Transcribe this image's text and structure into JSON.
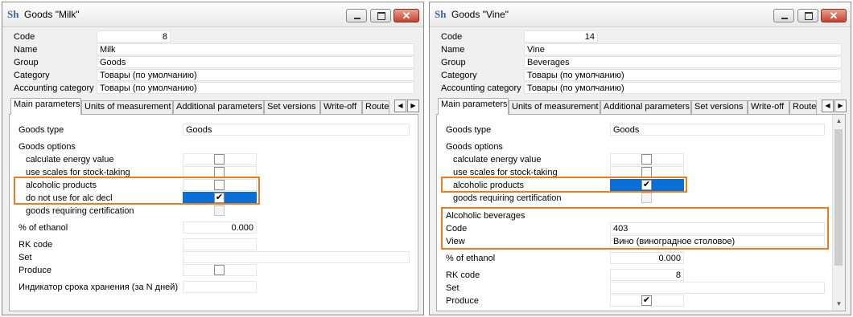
{
  "windows": [
    {
      "title": "Goods \"Milk\"",
      "close_glyph": "✕",
      "fields": {
        "code": {
          "label": "Code",
          "value": "8"
        },
        "name": {
          "label": "Name",
          "value": "Milk"
        },
        "group": {
          "label": "Group",
          "value": "Goods"
        },
        "category": {
          "label": "Category",
          "value": "Товары (по умолчанию)"
        },
        "accounting_category": {
          "label": "Accounting category",
          "value": "Товары (по умолчанию)"
        }
      },
      "tabs": [
        "Main parameters",
        "Units of measurement",
        "Additional parameters",
        "Set versions",
        "Write-off",
        "Route"
      ],
      "main": {
        "goods_type": {
          "label": "Goods type",
          "value": "Goods"
        },
        "goods_options": {
          "label": "Goods options"
        },
        "calc_energy": {
          "label": "calculate energy value",
          "checked": ""
        },
        "use_scales": {
          "label": "use scales for stock-taking",
          "checked": ""
        },
        "alcoholic": {
          "label": "alcoholic products",
          "checked": ""
        },
        "no_alc_decl": {
          "label": "do not use for alc decl",
          "checked": "✔"
        },
        "certification": {
          "label": "goods requiring certification",
          "checked": ""
        },
        "ethanol": {
          "label": "% of ethanol",
          "value": "0.000"
        },
        "rk_code": {
          "label": "RK code",
          "value": ""
        },
        "set": {
          "label": "Set",
          "value": ""
        },
        "produce": {
          "label": "Produce",
          "checked": ""
        },
        "shelf_life": {
          "label": "Индикатор срока хранения (за N дней)",
          "value": ""
        }
      }
    },
    {
      "title": "Goods \"Vine\"",
      "close_glyph": "✕",
      "fields": {
        "code": {
          "label": "Code",
          "value": "14"
        },
        "name": {
          "label": "Name",
          "value": "Vine"
        },
        "group": {
          "label": "Group",
          "value": "Beverages"
        },
        "category": {
          "label": "Category",
          "value": "Товары (по умолчанию)"
        },
        "accounting_category": {
          "label": "Accounting category",
          "value": "Товары (по умолчанию)"
        }
      },
      "tabs": [
        "Main parameters",
        "Units of measurement",
        "Additional parameters",
        "Set versions",
        "Write-off",
        "Route"
      ],
      "main": {
        "goods_type": {
          "label": "Goods type",
          "value": "Goods"
        },
        "goods_options": {
          "label": "Goods options"
        },
        "calc_energy": {
          "label": "calculate energy value",
          "checked": ""
        },
        "use_scales": {
          "label": "use scales for stock-taking",
          "checked": ""
        },
        "alcoholic": {
          "label": "alcoholic products",
          "checked": "✔"
        },
        "certification": {
          "label": "goods requiring certification",
          "checked": ""
        },
        "alc_bev": {
          "label": "Alcoholic beverages"
        },
        "alc_code": {
          "label": "Code",
          "value": "403"
        },
        "alc_view": {
          "label": "View",
          "value": "Вино (виноградное столовое)"
        },
        "ethanol": {
          "label": "% of ethanol",
          "value": "0.000"
        },
        "rk_code": {
          "label": "RK code",
          "value": "8"
        },
        "set": {
          "label": "Set",
          "value": ""
        },
        "produce": {
          "label": "Produce",
          "checked": "✔"
        }
      }
    }
  ],
  "colors": {
    "highlight": "#f07b1d",
    "selection": "#0a6fd6"
  },
  "icons": [
    "app-icon",
    "minimize-icon",
    "maximize-icon",
    "close-icon",
    "chevron-left-icon",
    "chevron-right-icon",
    "scroll-up-icon",
    "scroll-down-icon"
  ]
}
